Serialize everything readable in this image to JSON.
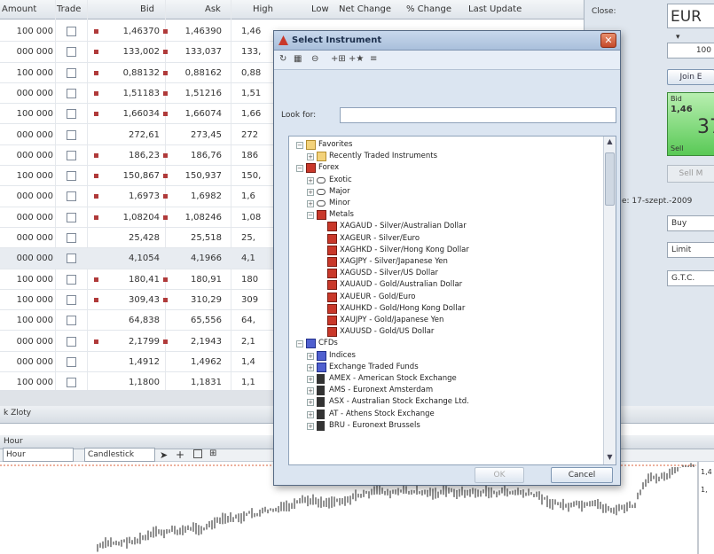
{
  "table": {
    "headers": [
      "Amount",
      "Trade",
      "Bid",
      "Ask",
      "High",
      "Low",
      "Net Change",
      "% Change",
      "Last Update"
    ],
    "rows": [
      {
        "amount": "100 000",
        "dir": "down",
        "bid": "1,46370",
        "dir2": "down",
        "ask": "1,46390",
        "high": "1,46"
      },
      {
        "amount": "000 000",
        "dir": "down",
        "bid": "133,002",
        "dir2": "down",
        "ask": "133,037",
        "high": "133,"
      },
      {
        "amount": "100 000",
        "dir": "down",
        "bid": "0,88132",
        "dir2": "down",
        "ask": "0,88162",
        "high": "0,88"
      },
      {
        "amount": "000 000",
        "dir": "down",
        "bid": "1,51183",
        "dir2": "down",
        "ask": "1,51216",
        "high": "1,51"
      },
      {
        "amount": "100 000",
        "dir": "down",
        "bid": "1,66034",
        "dir2": "down",
        "ask": "1,66074",
        "high": "1,66"
      },
      {
        "amount": "000 000",
        "dir": "",
        "bid": "272,61",
        "dir2": "",
        "ask": "273,45",
        "high": "272"
      },
      {
        "amount": "000 000",
        "dir": "down",
        "bid": "186,23",
        "dir2": "down",
        "ask": "186,76",
        "high": "186"
      },
      {
        "amount": "100 000",
        "dir": "down",
        "bid": "150,867",
        "dir2": "down",
        "ask": "150,937",
        "high": "150,"
      },
      {
        "amount": "000 000",
        "dir": "down",
        "bid": "1,6973",
        "dir2": "down",
        "ask": "1,6982",
        "high": "1,6"
      },
      {
        "amount": "000 000",
        "dir": "down",
        "bid": "1,08204",
        "dir2": "down",
        "ask": "1,08246",
        "high": "1,08"
      },
      {
        "amount": "000 000",
        "dir": "",
        "bid": "25,428",
        "dir2": "",
        "ask": "25,518",
        "high": "25,"
      },
      {
        "amount": "000 000",
        "dir": "",
        "bid": "4,1054",
        "dir2": "",
        "ask": "4,1966",
        "high": "4,1"
      },
      {
        "amount": "100 000",
        "dir": "down",
        "bid": "180,41",
        "dir2": "down",
        "ask": "180,91",
        "high": "180"
      },
      {
        "amount": "100 000",
        "dir": "down",
        "bid": "309,43",
        "dir2": "down",
        "ask": "310,29",
        "high": "309"
      },
      {
        "amount": "100 000",
        "dir": "",
        "bid": "64,838",
        "dir2": "",
        "ask": "65,556",
        "high": "64,"
      },
      {
        "amount": "000 000",
        "dir": "down",
        "bid": "2,1799",
        "dir2": "down",
        "ask": "2,1943",
        "high": "2,1"
      },
      {
        "amount": "000 000",
        "dir": "",
        "bid": "1,4912",
        "dir2": "",
        "ask": "1,4962",
        "high": "1,4"
      },
      {
        "amount": "100 000",
        "dir": "",
        "bid": "1,1800",
        "dir2": "",
        "ask": "1,1831",
        "high": "1,1"
      }
    ]
  },
  "right_panel": {
    "close_label": "Close:",
    "currency": "EUR",
    "amount_value": "100",
    "join_label": "Join E",
    "bid_label": "Bid",
    "bid_value": "1,46",
    "big_digits": "37",
    "sell_label": "Sell",
    "sell_btn": "Sell M",
    "date_label": "e: 17-szept.-2009",
    "side_value": "Buy",
    "type_value": "Limit",
    "validity_value": "G.T.C.",
    "arrow": "▾"
  },
  "bottom": {
    "strip1_text": "k Zloty",
    "strip2_text": "Hour",
    "period_value": "Hour",
    "chart_type_value": "Candlestick",
    "price_labels": [
      "1,4",
      "1,"
    ]
  },
  "dialog": {
    "title": "Select Instrument",
    "close_glyph": "✕",
    "lookfor_label": "Look for:",
    "lookfor_value": "",
    "ok_label": "OK",
    "cancel_label": "Cancel",
    "tree": [
      {
        "level": 0,
        "exp": "−",
        "icon": "folder",
        "label": "Favorites"
      },
      {
        "level": 1,
        "exp": "+",
        "icon": "folder",
        "label": "Recently Traded Instruments"
      },
      {
        "level": 0,
        "exp": "−",
        "icon": "red",
        "label": "Forex"
      },
      {
        "level": 1,
        "exp": "+",
        "icon": "circle",
        "label": "Exotic"
      },
      {
        "level": 1,
        "exp": "+",
        "icon": "circle",
        "label": "Major"
      },
      {
        "level": 1,
        "exp": "+",
        "icon": "circle",
        "label": "Minor"
      },
      {
        "level": 1,
        "exp": "−",
        "icon": "red",
        "label": "Metals"
      },
      {
        "level": 2,
        "exp": "",
        "icon": "red",
        "label": "XAGAUD - Silver/Australian Dollar"
      },
      {
        "level": 2,
        "exp": "",
        "icon": "red",
        "label": "XAGEUR - Silver/Euro"
      },
      {
        "level": 2,
        "exp": "",
        "icon": "red",
        "label": "XAGHKD - Silver/Hong Kong Dollar"
      },
      {
        "level": 2,
        "exp": "",
        "icon": "red",
        "label": "XAGJPY - Silver/Japanese Yen"
      },
      {
        "level": 2,
        "exp": "",
        "icon": "red",
        "label": "XAGUSD - Silver/US Dollar"
      },
      {
        "level": 2,
        "exp": "",
        "icon": "red",
        "label": "XAUAUD - Gold/Australian Dollar"
      },
      {
        "level": 2,
        "exp": "",
        "icon": "red",
        "label": "XAUEUR - Gold/Euro"
      },
      {
        "level": 2,
        "exp": "",
        "icon": "red",
        "label": "XAUHKD - Gold/Hong Kong Dollar"
      },
      {
        "level": 2,
        "exp": "",
        "icon": "red",
        "label": "XAUJPY - Gold/Japanese Yen"
      },
      {
        "level": 2,
        "exp": "",
        "icon": "red",
        "label": "XAUUSD - Gold/US Dollar"
      },
      {
        "level": 0,
        "exp": "−",
        "icon": "blue",
        "label": "CFDs"
      },
      {
        "level": 1,
        "exp": "+",
        "icon": "blue",
        "label": "Indices"
      },
      {
        "level": 1,
        "exp": "+",
        "icon": "blue",
        "label": "Exchange Traded Funds"
      },
      {
        "level": 1,
        "exp": "+",
        "icon": "bank",
        "label": "AMEX - American Stock Exchange"
      },
      {
        "level": 1,
        "exp": "+",
        "icon": "bank",
        "label": "AMS - Euronext Amsterdam"
      },
      {
        "level": 1,
        "exp": "+",
        "icon": "bank",
        "label": "ASX - Australian Stock Exchange Ltd."
      },
      {
        "level": 1,
        "exp": "+",
        "icon": "bank",
        "label": "AT - Athens Stock Exchange"
      },
      {
        "level": 1,
        "exp": "+",
        "icon": "bank",
        "label": "BRU - Euronext Brussels"
      }
    ]
  },
  "colors": {
    "accent": "#3b6fb0",
    "down": "#b03a3a",
    "bid_green": "#59c956",
    "chart_line": "#222222",
    "ref_line": "#d9603b"
  }
}
